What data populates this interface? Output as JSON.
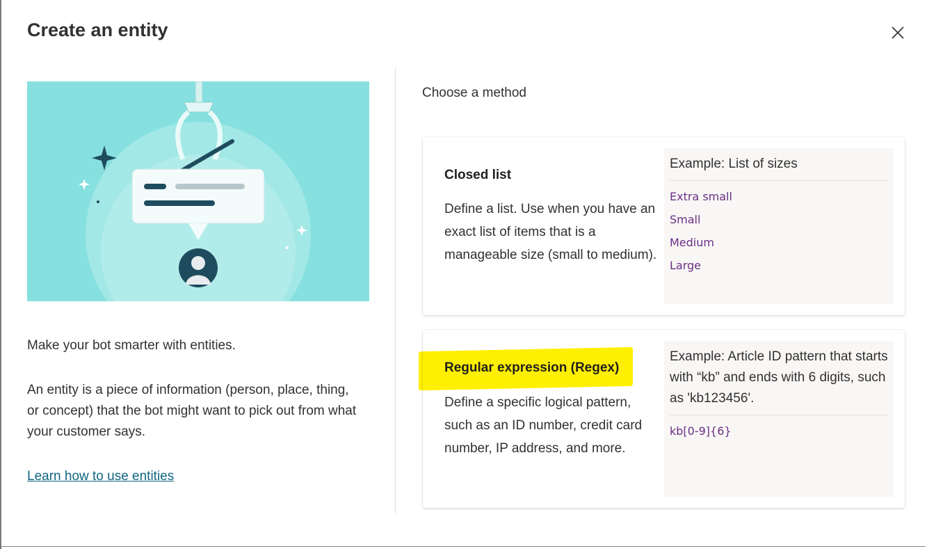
{
  "dialog": {
    "title": "Create an entity",
    "close_icon": "close-icon"
  },
  "left": {
    "intro": "Make your bot smarter with entities.",
    "description": "An entity is a piece of information (person, place, thing, or concept) that the bot might want to pick out from what your customer says.",
    "learn_link": "Learn how to use entities"
  },
  "right": {
    "heading": "Choose a method",
    "methods": [
      {
        "name": "Closed list",
        "description": "Define a list. Use when you have an exact list of items that is a manageable size (small to medium).",
        "example_title": "Example: List of sizes",
        "example_items": [
          "Extra small",
          "Small",
          "Medium",
          "Large"
        ]
      },
      {
        "name": "Regular expression (Regex)",
        "description": "Define a specific logical pattern, such as an ID number, credit card number, IP address, and more.",
        "example_title": "Example: Article ID pattern that starts with “kb” and ends with 6 digits, such as 'kb123456'.",
        "example_items": [
          "kb[0-9]{6}"
        ]
      }
    ]
  },
  "colors": {
    "hero_background": "#86e0df",
    "link": "#0f6580",
    "example_text": "#6b2f84",
    "highlight": "#ffef00"
  }
}
